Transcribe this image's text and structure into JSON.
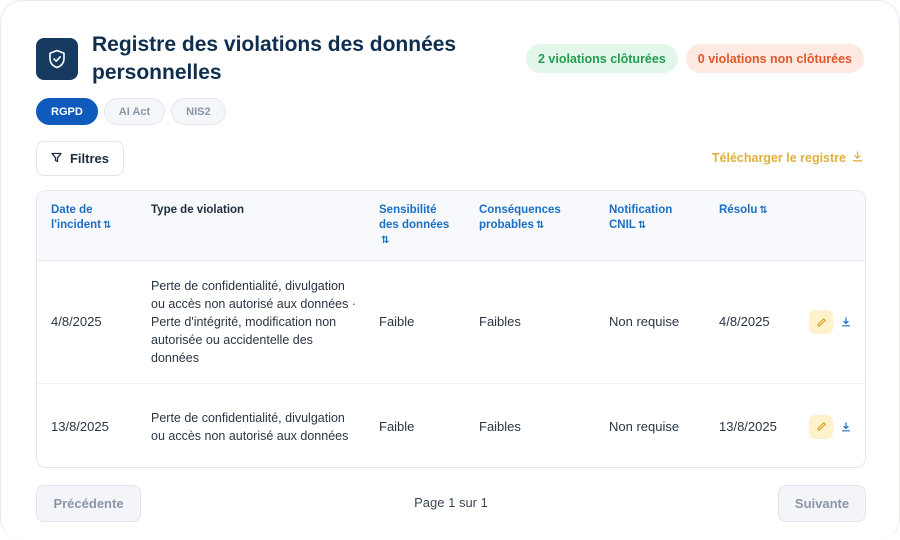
{
  "header": {
    "title": "Registre des violations des données personnelles",
    "badge_closed": "2 violations clôturées",
    "badge_open": "0 violations non clôturées"
  },
  "tags": [
    "RGPD",
    "AI Act",
    "NIS2"
  ],
  "toolbar": {
    "filter_label": "Filtres",
    "download_label": "Télécharger le registre"
  },
  "table": {
    "columns": {
      "date": "Date de l'incident",
      "type": "Type de violation",
      "sensitivity": "Sensibilité des données",
      "consequences": "Conséquences probables",
      "notification": "Notification CNIL",
      "resolved": "Résolu"
    },
    "rows": [
      {
        "date": "4/8/2025",
        "type": "Perte de confidentialité, divulgation ou accès non autorisé aux données · Perte d'intégrité, modification non autorisée ou accidentelle des données",
        "sensitivity": "Faible",
        "consequences": "Faibles",
        "notification": "Non requise",
        "resolved": "4/8/2025"
      },
      {
        "date": "13/8/2025",
        "type": "Perte de confidentialité, divulgation ou accès non autorisé aux données",
        "sensitivity": "Faible",
        "consequences": "Faibles",
        "notification": "Non requise",
        "resolved": "13/8/2025"
      }
    ]
  },
  "pager": {
    "prev_label": "Précédente",
    "info": "Page 1 sur 1",
    "next_label": "Suivante"
  },
  "colors": {
    "primary": "#0f5bbd",
    "title": "#0f2e4f",
    "accent_download": "#e0b13a",
    "badge_green": "#239c52",
    "badge_orange": "#e2572a"
  },
  "icons": {
    "shield": "shield-check-icon",
    "filter": "filter-icon",
    "download": "download-icon",
    "edit": "pencil-icon",
    "sort": "sort-arrows-icon"
  }
}
